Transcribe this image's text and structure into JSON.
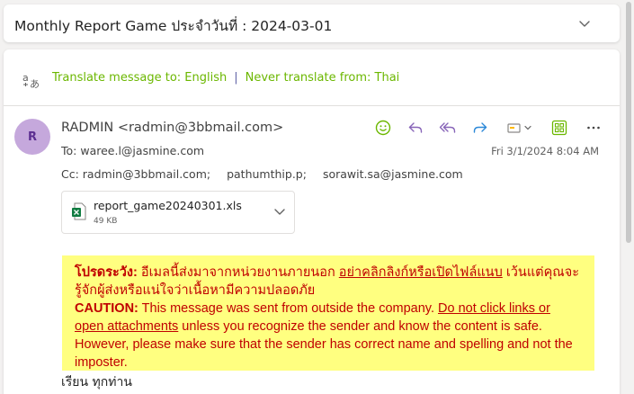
{
  "subject": "Monthly Report Game ประจำวันที่ : 2024-03-01",
  "translate": {
    "translate_to": "Translate message to: English",
    "separator": "|",
    "never_translate": "Never translate from: Thai"
  },
  "sender": {
    "initial": "R",
    "name_and_email": "RADMIN <radmin@3bbmail.com>",
    "to_label": "To:",
    "to": "waree.l@jasmine.com",
    "cc_label": "Cc:",
    "cc": [
      "radmin@3bbmail.com;",
      "pathumthip.p;",
      "sorawit.sa@jasmine.com"
    ],
    "datetime": "Fri 3/1/2024 8:04 AM"
  },
  "actions": {
    "icons": [
      "emoji-icon",
      "reply-icon",
      "reply-all-icon",
      "forward-icon",
      "more-actions-dropdown-icon",
      "apps-icon",
      "more-icon"
    ]
  },
  "attachment": {
    "filename": "report_game20240301.xls",
    "size": "49 KB"
  },
  "caution": {
    "th_label": "โปรดระวัง:",
    "th_text_1": " อีเมลนี้ส่งมาจากหน่วยงานภายนอก ",
    "th_link": "อย่าคลิกลิงก์หรือเปิดไฟล์แนบ",
    "th_text_2": " เว้นแต่คุณจะรู้จักผู้ส่งหรือแน่ใจว่าเนื้อหามีความปลอดภัย",
    "en_label": "CAUTION:",
    "en_text_1": " This message was sent from outside the company. ",
    "en_link": "Do not click links or open attachments",
    "en_text_2": " unless you recognize the sender and know the content is safe. However, please make sure that the sender has correct name and spelling and not the imposter."
  },
  "body": {
    "greeting": "เรียน ทุกท่าน"
  },
  "colors": {
    "accent_green": "#6bb700",
    "accent_purple": "#6264a7",
    "caution_bg": "#ffff80",
    "caution_text": "#c00000",
    "avatar_bg": "#c5a8dc"
  }
}
